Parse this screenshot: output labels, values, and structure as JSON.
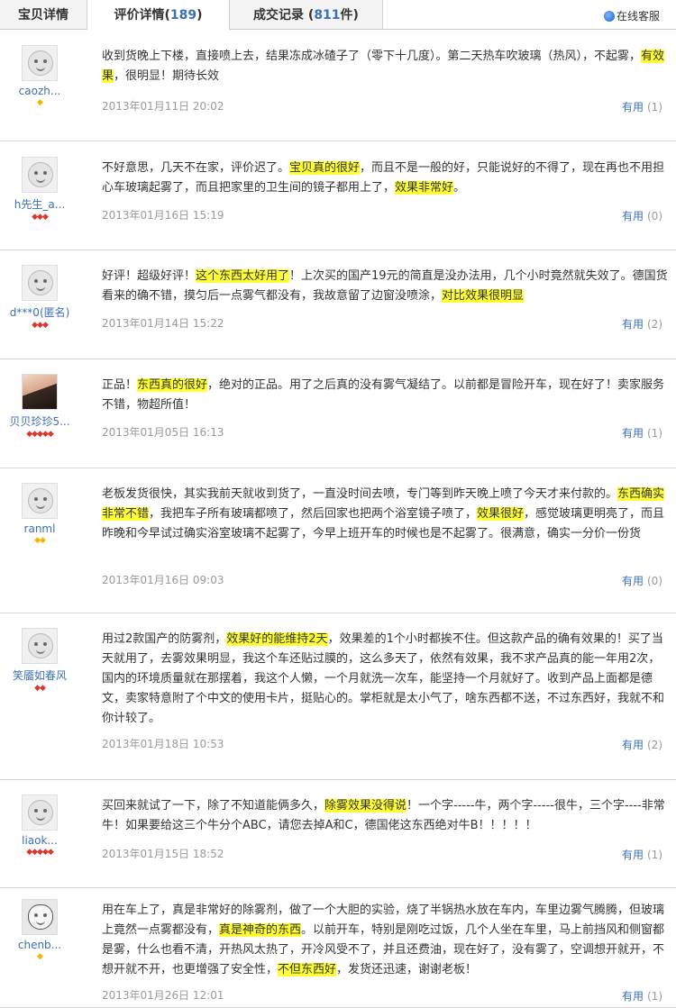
{
  "tabs": [
    {
      "label": "宝贝详情"
    },
    {
      "label": "评价详情(",
      "count": "189",
      "close": ")"
    },
    {
      "label": "成交记录 (",
      "count": "811",
      "close": "件)"
    }
  ],
  "service_label": "在线客服",
  "reviews": [
    {
      "user": "caozh...",
      "avatar": "default",
      "rank": "◆",
      "rank_color": "gold",
      "parts": [
        {
          "t": "收到货晚上下楼，直接喷上去，结果冻成冰碴子了（零下十几度）。第二天热车吹玻璃（热风），不起雾，"
        },
        {
          "t": "有效果",
          "hl": true
        },
        {
          "t": "，很明显！期待长效"
        }
      ],
      "date": "2013年01月11日 20:02",
      "useful_label": "有用",
      "useful_count": "(1)"
    },
    {
      "user": "h先生_a...",
      "avatar": "default",
      "rank": "◆◆◆",
      "rank_color": "red",
      "parts": [
        {
          "t": "不好意思，几天不在家，评价迟了。"
        },
        {
          "t": "宝贝真的很好",
          "hl": true
        },
        {
          "t": "，而且不是一般的好，只能说好的不得了，现在再也不用担心车玻璃起雾了，而且把家里的卫生间的镜子都用上了，"
        },
        {
          "t": "效果非常好",
          "hl": true
        },
        {
          "t": "。"
        }
      ],
      "date": "2013年01月16日 15:19",
      "useful_label": "有用",
      "useful_count": "(0)"
    },
    {
      "user": "d***0(匿名)",
      "avatar": "default",
      "rank": "◆◆◆",
      "rank_color": "red",
      "parts": [
        {
          "t": "好评！超级好评！"
        },
        {
          "t": "这个东西太好用了",
          "hl": true
        },
        {
          "t": "！上次买的国产19元的简直是没办法用，几个小时竟然就失效了。德国货看来的确不错，摸匀后一点雾气都没有，我故意留了边窗没喷涂，"
        },
        {
          "t": "对比效果很明显",
          "hl": true
        }
      ],
      "date": "2013年01月14日 15:22",
      "useful_label": "有用",
      "useful_count": "(2)"
    },
    {
      "user": "贝贝珍珍5...",
      "avatar": "photo",
      "rank": "◆◆◆◆◆",
      "rank_color": "red",
      "parts": [
        {
          "t": "正品！"
        },
        {
          "t": "东西真的很好",
          "hl": true
        },
        {
          "t": "，绝对的正品。用了之后真的没有雾气凝结了。以前都是冒险开车，现在好了！卖家服务不错，物超所值！"
        }
      ],
      "date": "2013年01月05日 16:13",
      "useful_label": "有用",
      "useful_count": "(1)"
    },
    {
      "user": "ranml",
      "avatar": "default",
      "rank": "◆◆",
      "rank_color": "gold",
      "parts": [
        {
          "t": "老板发货很快，其实我前天就收到货了，一直没时间去喷，专门等到昨天晚上喷了今天才来付款的。"
        },
        {
          "t": "东西确实非常不错",
          "hl": true
        },
        {
          "t": "，我把车子所有玻璃都喷了，然后回家也把两个浴室镜子喷了，"
        },
        {
          "t": "效果很好",
          "hl": true
        },
        {
          "t": "，感觉玻璃更明亮了，而且昨晚和今早试过确实浴室玻璃不起雾了，今早上班开车的时候也是不起雾了。很满意，确实一分价一份货"
        }
      ],
      "date": "2013年01月16日 09:03",
      "useful_label": "有用",
      "useful_count": "(0)"
    },
    {
      "user": "笑靥如春风",
      "avatar": "default",
      "rank": "◆◆",
      "rank_color": "red",
      "parts": [
        {
          "t": "用过2款国产的防雾剂，"
        },
        {
          "t": "效果好的能维持2天",
          "hl": true
        },
        {
          "t": "，效果差的1个小时都挨不住。但这款产品的确有效果的！买了当天就用了，去雾效果明显，我这个车还贴过膜的，这么多天了，依然有效果，我不求产品真的能一年用2次，国内的环境质量就在那摆着，我这个人懒，一个月就洗一次车，能坚持一个月就好了。收到产品上面都是德文，卖家特意附了个中文的使用卡片，挺贴心的。掌柜就是太小气了，啥东西都不送，不过东西好，我就不和你计较了。"
        }
      ],
      "date": "2013年01月18日 10:53",
      "useful_label": "有用",
      "useful_count": "(2)"
    },
    {
      "user": "liaok...",
      "avatar": "default",
      "rank": "◆◆◆◆◆",
      "rank_color": "red",
      "parts": [
        {
          "t": "买回来就试了一下，除了不知道能俩多久，"
        },
        {
          "t": "除雾效果没得说",
          "hl": true
        },
        {
          "t": "！一个字-----牛，两个字-----很牛，三个字----非常牛！如果要给这三个牛分个ABC，请您去掉A和C，德国佬这东西绝对牛B！！！！！"
        }
      ],
      "date": "2013年01月15日 18:52",
      "useful_label": "有用",
      "useful_count": "(1)"
    },
    {
      "user": "chenb...",
      "avatar": "skull",
      "rank": "◆",
      "rank_color": "gold",
      "parts": [
        {
          "t": "用在车上了，真是非常好的除雾剂，做了一个大胆的实验，烧了半锅热水放在车内，车里边雾气腾腾，但玻璃上竟然一点雾都没有，"
        },
        {
          "t": "真是神奇的东西",
          "hl": true
        },
        {
          "t": "。以前开车，特别是刚吃过饭，几个人坐在车里，马上前挡风和侧窗都是雾，什么也看不清，开热风太热了，开冷风受不了，并且还费油，现在好了，没有雾了，空调想开就开，不想开就不开，也更增强了安全性，"
        },
        {
          "t": "不但东西好",
          "hl": true
        },
        {
          "t": "，发货还迅速，谢谢老板！"
        }
      ],
      "date": "2013年01月26日 12:01",
      "useful_label": "有用",
      "useful_count": "(1)"
    }
  ]
}
